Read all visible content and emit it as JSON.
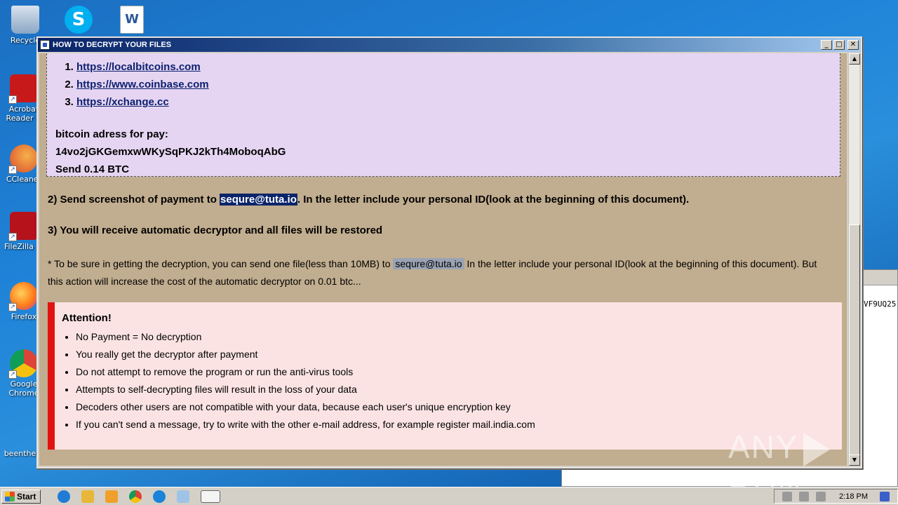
{
  "desktop": {
    "icons": [
      {
        "label": "Recycle",
        "color": "#8aa6c4"
      },
      {
        "label": "Acrobat Reader D",
        "color": "#c8191a"
      },
      {
        "label": "CCleaner",
        "color": "#d84a2a"
      },
      {
        "label": "FileZilla Cl",
        "color": "#b5121b"
      },
      {
        "label": "Firefox",
        "color": "#ff7a18"
      },
      {
        "label": "Google Chrome",
        "color": "#34a853"
      },
      {
        "label": "beenthere",
        "color": "#1e6cc0"
      }
    ],
    "top_icons": [
      {
        "name": "skype",
        "color": "#00aff0",
        "glyph": "S"
      },
      {
        "name": "word",
        "color": "#2b579a",
        "glyph": "W"
      }
    ]
  },
  "background_window": {
    "visible_text": "VF9UQ25"
  },
  "window": {
    "title": "HOW TO DECRYPT YOUR FILES",
    "buttons": {
      "minimize": "_",
      "maximize": "□",
      "close": "✕"
    }
  },
  "content": {
    "exchange_links": [
      "https://localbitcoins.com",
      "https://www.coinbase.com",
      "https://xchange.cc"
    ],
    "btc_label": "bitcoin adress for pay:",
    "btc_address": "14vo2jGKGemxwWKySqPKJ2kTh4MoboqAbG",
    "btc_amount": "Send 0.14 BTC",
    "step2_prefix": "2) Send screenshot of payment to ",
    "step2_email": "sequre@tuta.io",
    "step2_suffix": ". In the letter include your personal ID(look at the beginning of this document).",
    "step3": "3) You will receive automatic decryptor and all files will be restored",
    "note_prefix": "* To be sure in getting the decryption, you can send one file(less than 10MB) to ",
    "note_email": "sequre@tuta.io",
    "note_suffix": " In the letter include your personal ID(look at the beginning of this document). But this action will increase the cost of the automatic decryptor on 0.01 btc...",
    "attention_title": "Attention!",
    "attention_items": [
      "No Payment = No decryption",
      "You really get the decryptor after payment",
      "Do not attempt to remove the program or run the anti-virus tools",
      "Attempts to self-decrypting files will result in the loss of your data",
      "Decoders other users are not compatible with your data, because each user's unique encryption key",
      "If you can't send a message, try to write with the other e-mail address, for example register mail.india.com"
    ]
  },
  "watermark": {
    "left": "ANY",
    "right": "RUN"
  },
  "taskbar": {
    "start_label": "Start",
    "quick_launch": [
      {
        "name": "ie-icon",
        "color": "#1f7bd6"
      },
      {
        "name": "explorer-icon",
        "color": "#e8b73a"
      },
      {
        "name": "media-player-icon",
        "color": "#f0a02a"
      },
      {
        "name": "chrome-icon",
        "color": "#db4437"
      },
      {
        "name": "edge-icon",
        "color": "#1a84d8"
      },
      {
        "name": "notepad-icon",
        "color": "#9fc3e6"
      },
      {
        "name": "active-window-icon",
        "color": "#3a5fc8"
      }
    ],
    "clock": "2:18 PM"
  }
}
